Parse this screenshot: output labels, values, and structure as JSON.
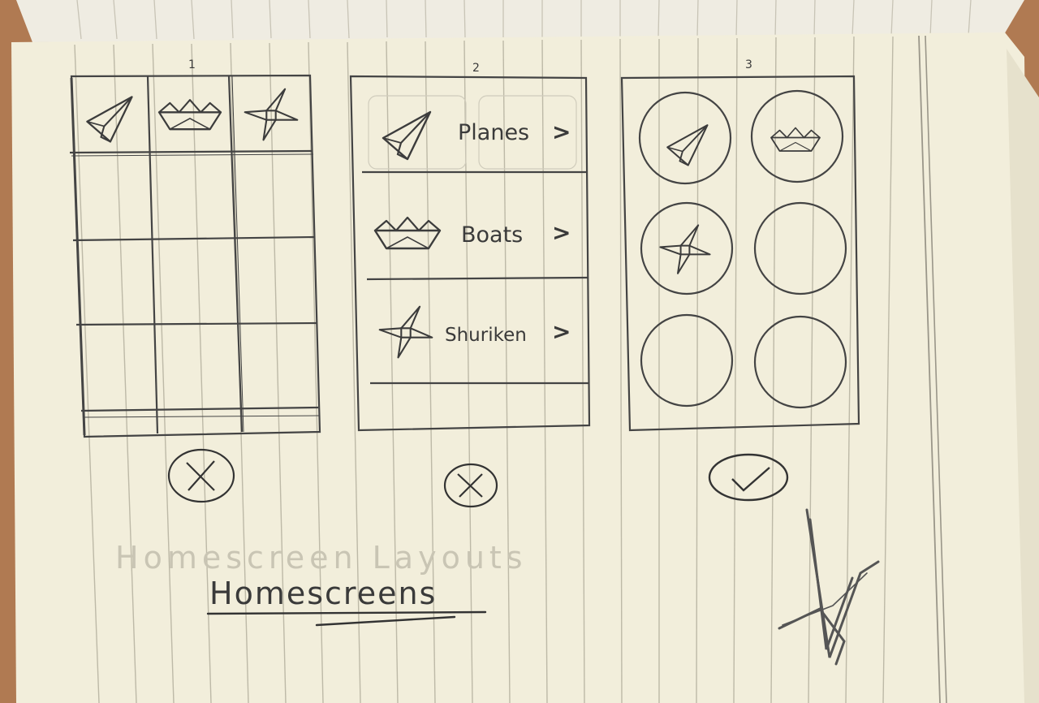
{
  "sketch": {
    "wireframe_numbers": [
      "1",
      "2",
      "3"
    ],
    "list_items": [
      {
        "label": "Planes",
        "arrow": ">"
      },
      {
        "label": "Boats",
        "arrow": ">"
      },
      {
        "label": "Shuriken",
        "arrow": ">"
      }
    ],
    "faded_heading": "Homescreen Layouts",
    "heading": "Homescreens",
    "verdicts": [
      "rejected",
      "rejected",
      "approved"
    ]
  },
  "icons": [
    "paper-plane-icon",
    "paper-boat-icon",
    "shuriken-icon",
    "cross-mark-icon",
    "check-mark-icon"
  ],
  "colors": {
    "paper": "#f2eedb",
    "pencil": "#3c3c3c",
    "line": "#b9b5a4",
    "table": "#b07a52"
  }
}
